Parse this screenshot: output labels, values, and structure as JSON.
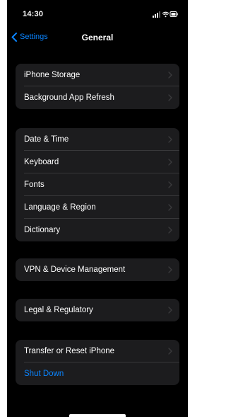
{
  "status_bar": {
    "time": "14:30",
    "icons": [
      "cellular-signal-icon",
      "wifi-icon",
      "battery-icon"
    ]
  },
  "nav": {
    "back_label": "Settings",
    "back_icon": "chevron-left-icon",
    "title": "General"
  },
  "groups": [
    {
      "items": [
        {
          "label": "iPhone Storage"
        },
        {
          "label": "Background App Refresh"
        }
      ]
    },
    {
      "items": [
        {
          "label": "Date & Time"
        },
        {
          "label": "Keyboard"
        },
        {
          "label": "Fonts"
        },
        {
          "label": "Language & Region"
        },
        {
          "label": "Dictionary"
        }
      ]
    },
    {
      "items": [
        {
          "label": "VPN & Device Management"
        }
      ]
    },
    {
      "items": [
        {
          "label": "Legal & Regulatory"
        }
      ]
    },
    {
      "items": [
        {
          "label": "Transfer or Reset iPhone"
        },
        {
          "label": "Shut Down"
        }
      ]
    }
  ],
  "colors": {
    "background": "#000000",
    "cell": "#1c1c1e",
    "separator": "#38383a",
    "accent": "#0a84ff",
    "text": "#ffffff",
    "chevron": "#3a3a3c"
  }
}
